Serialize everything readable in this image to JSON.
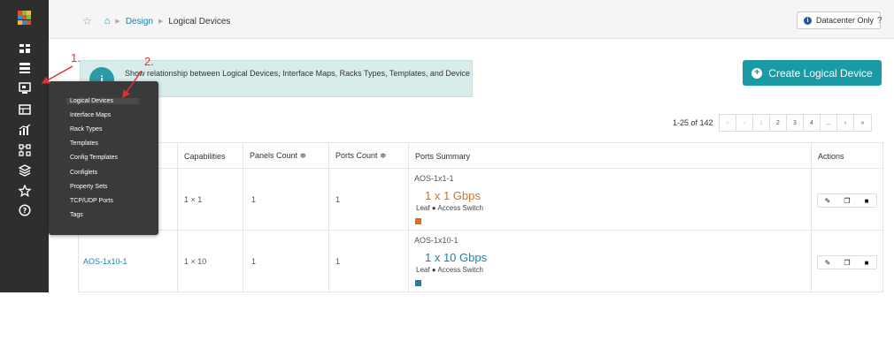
{
  "sidebar": {
    "logo_colors": [
      "#e04d2b",
      "#7fbf3f",
      "#f2b84b",
      "#2a8ed1",
      "#e04d2b",
      "#7fbf3f",
      "#f2b84b",
      "#2a8ed1",
      "#e04d2b"
    ],
    "icons": [
      "dashboard-icon",
      "blueprints-icon",
      "devices-icon",
      "design-icon",
      "analytics-icon",
      "resources-icon",
      "external-systems-icon",
      "favorites-icon",
      "help-icon"
    ]
  },
  "breadcrumb": {
    "section": "Design",
    "current": "Logical Devices"
  },
  "topbar": {
    "datacenter_label": "Datacenter Only",
    "help_label": "?"
  },
  "banner": {
    "text": "Show relationship between Logical Devices, Interface Maps, Racks Types, Templates, and Device"
  },
  "create_button": {
    "label": "Create Logical Device"
  },
  "pager": {
    "count": "1-25 of 142",
    "pages": [
      "«",
      "‹",
      "1",
      "2",
      "3",
      "4",
      "...",
      "›",
      "»"
    ]
  },
  "table": {
    "columns": [
      "Capabilities",
      "Panels Count ≑",
      "Ports Count ≑",
      "Ports Summary",
      "Actions"
    ],
    "rows": [
      {
        "name": "",
        "capabilities": "1 × 1",
        "panels": "1",
        "ports": "1",
        "summary_name": "AOS-1x1-1",
        "summary_speed": "1 x 1 Gbps",
        "summary_role": "Leaf ● Access Switch",
        "color": "#d8701f"
      },
      {
        "name": "AOS-1x10-1",
        "capabilities": "1 × 10",
        "panels": "1",
        "ports": "1",
        "summary_name": "AOS-1x10-1",
        "summary_speed": "1 x 10 Gbps",
        "summary_role": "Leaf ● Access Switch",
        "color": "#1c7fb0"
      }
    ]
  },
  "menu": {
    "items": [
      "Logical Devices",
      "Interface Maps",
      "Rack Types",
      "Templates",
      "Config Templates",
      "Configlets",
      "Property Sets",
      "TCP/UDP Ports",
      "Tags"
    ]
  },
  "annotations": {
    "step1": "1.",
    "step2": "2."
  },
  "colors": {
    "accent": "#1a9aa5",
    "sidebar": "#2e2e2e",
    "link": "#1c7fb0",
    "annotation": "#e03030"
  }
}
